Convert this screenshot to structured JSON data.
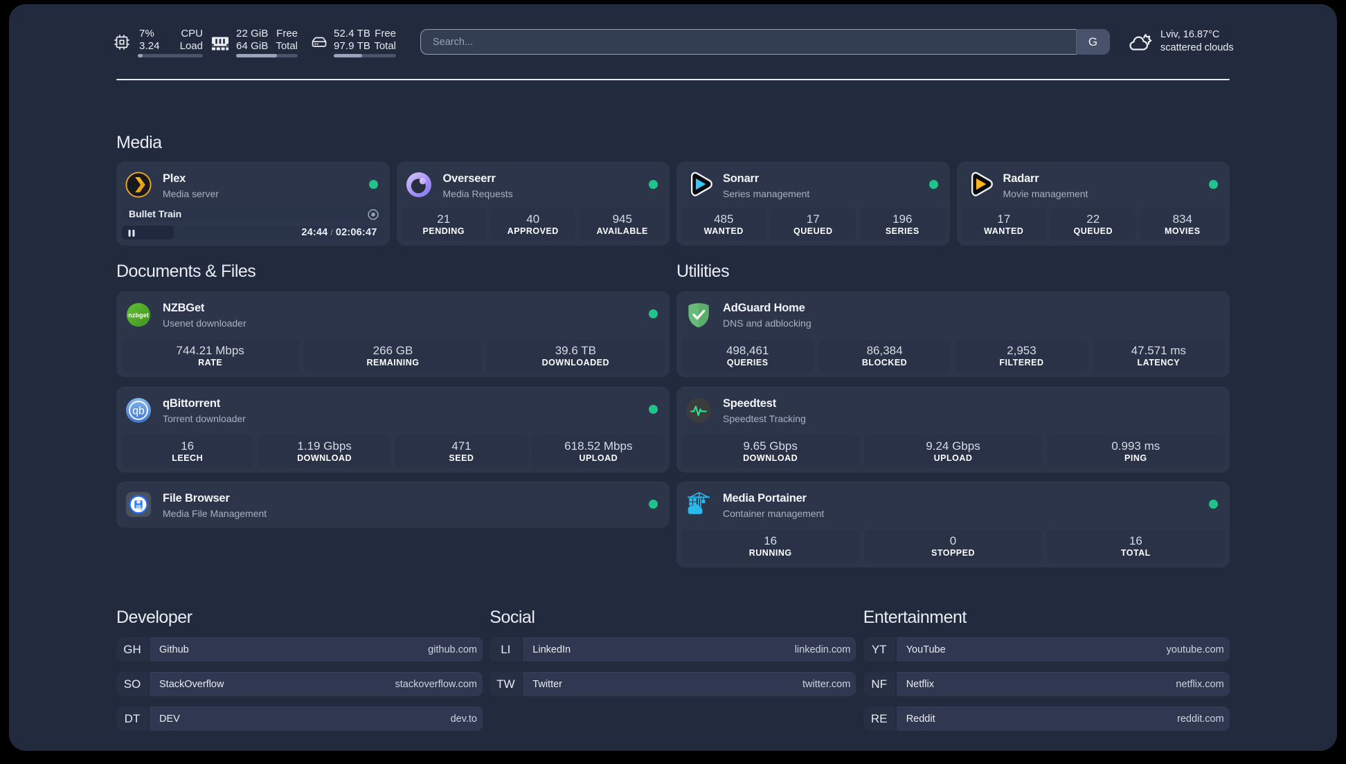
{
  "topbar": {
    "cpu": {
      "value1": "7%",
      "value2": "3.24",
      "label1": "CPU",
      "label2": "Load",
      "progress": 7
    },
    "memory": {
      "value1": "22 GiB",
      "value2": "64 GiB",
      "label1": "Free",
      "label2": "Total",
      "progress": 66
    },
    "disk": {
      "value1": "52.4 TB",
      "value2": "97.9 TB",
      "label1": "Free",
      "label2": "Total",
      "progress": 46
    },
    "search": {
      "placeholder": "Search...",
      "engine_button": "G"
    },
    "weather": {
      "location_temp": "Lviv, 16.87°C",
      "condition": "scattered clouds"
    }
  },
  "colors": {
    "background": "#222A3D",
    "card": "#2C3549",
    "stat_box": "#293247",
    "online_dot": "#21C38D",
    "accent_plex": "#E5A00D",
    "accent_sonarr": "#35C5F1",
    "accent_radarr": "#FFC230",
    "accent_portainer": "#29B8EA"
  },
  "sections": {
    "media": {
      "title": "Media",
      "apps": [
        {
          "name": "Plex",
          "description": "Media server",
          "status": "online",
          "now_playing": {
            "title": "Bullet Train",
            "position": "24:44",
            "separator": "/",
            "duration": "02:06:47"
          }
        },
        {
          "name": "Overseerr",
          "description": "Media Requests",
          "status": "online",
          "stats": [
            {
              "value": "21",
              "label": "PENDING"
            },
            {
              "value": "40",
              "label": "APPROVED"
            },
            {
              "value": "945",
              "label": "AVAILABLE"
            }
          ]
        },
        {
          "name": "Sonarr",
          "description": "Series management",
          "status": "online",
          "stats": [
            {
              "value": "485",
              "label": "WANTED"
            },
            {
              "value": "17",
              "label": "QUEUED"
            },
            {
              "value": "196",
              "label": "SERIES"
            }
          ]
        },
        {
          "name": "Radarr",
          "description": "Movie management",
          "status": "online",
          "stats": [
            {
              "value": "17",
              "label": "WANTED"
            },
            {
              "value": "22",
              "label": "QUEUED"
            },
            {
              "value": "834",
              "label": "MOVIES"
            }
          ]
        }
      ]
    },
    "documents": {
      "title": "Documents & Files",
      "apps": [
        {
          "name": "NZBGet",
          "description": "Usenet downloader",
          "status": "online",
          "stats": [
            {
              "value": "744.21 Mbps",
              "label": "RATE"
            },
            {
              "value": "266 GB",
              "label": "REMAINING"
            },
            {
              "value": "39.6 TB",
              "label": "DOWNLOADED"
            }
          ]
        },
        {
          "name": "qBittorrent",
          "description": "Torrent downloader",
          "status": "online",
          "stats": [
            {
              "value": "16",
              "label": "LEECH"
            },
            {
              "value": "1.19 Gbps",
              "label": "DOWNLOAD"
            },
            {
              "value": "471",
              "label": "SEED"
            },
            {
              "value": "618.52 Mbps",
              "label": "UPLOAD"
            }
          ]
        },
        {
          "name": "File Browser",
          "description": "Media File Management",
          "status": "online"
        }
      ]
    },
    "utilities": {
      "title": "Utilities",
      "apps": [
        {
          "name": "AdGuard Home",
          "description": "DNS and adblocking",
          "stats": [
            {
              "value": "498,461",
              "label": "QUERIES"
            },
            {
              "value": "86,384",
              "label": "BLOCKED"
            },
            {
              "value": "2,953",
              "label": "FILTERED"
            },
            {
              "value": "47.571 ms",
              "label": "LATENCY"
            }
          ]
        },
        {
          "name": "Speedtest",
          "description": "Speedtest Tracking",
          "stats": [
            {
              "value": "9.65 Gbps",
              "label": "DOWNLOAD"
            },
            {
              "value": "9.24 Gbps",
              "label": "UPLOAD"
            },
            {
              "value": "0.993 ms",
              "label": "PING"
            }
          ]
        },
        {
          "name": "Media Portainer",
          "description": "Container management",
          "status": "online",
          "stats": [
            {
              "value": "16",
              "label": "RUNNING"
            },
            {
              "value": "0",
              "label": "STOPPED"
            },
            {
              "value": "16",
              "label": "TOTAL"
            }
          ]
        }
      ]
    },
    "bookmark_groups": [
      {
        "title": "Developer",
        "links": [
          {
            "abbr": "GH",
            "name": "Github",
            "domain": "github.com"
          },
          {
            "abbr": "SO",
            "name": "StackOverflow",
            "domain": "stackoverflow.com"
          },
          {
            "abbr": "DT",
            "name": "DEV",
            "domain": "dev.to"
          }
        ]
      },
      {
        "title": "Social",
        "links": [
          {
            "abbr": "LI",
            "name": "LinkedIn",
            "domain": "linkedin.com"
          },
          {
            "abbr": "TW",
            "name": "Twitter",
            "domain": "twitter.com"
          }
        ]
      },
      {
        "title": "Entertainment",
        "links": [
          {
            "abbr": "YT",
            "name": "YouTube",
            "domain": "youtube.com"
          },
          {
            "abbr": "NF",
            "name": "Netflix",
            "domain": "netflix.com"
          },
          {
            "abbr": "RE",
            "name": "Reddit",
            "domain": "reddit.com"
          }
        ]
      }
    ]
  }
}
